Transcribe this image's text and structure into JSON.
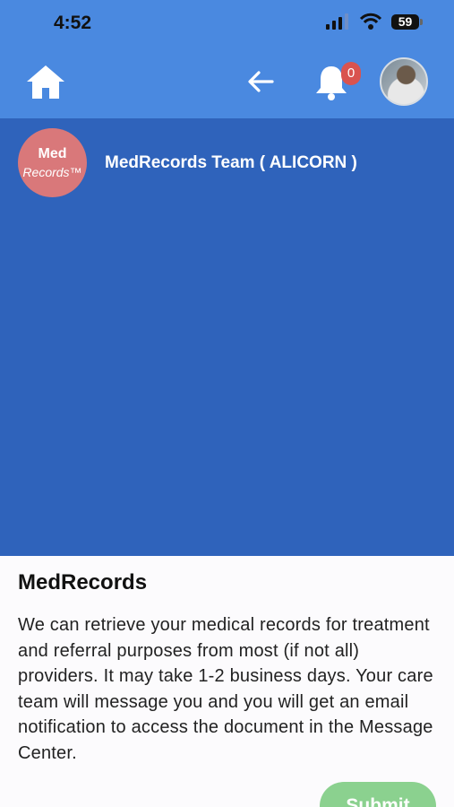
{
  "status_bar": {
    "time": "4:52",
    "battery": "59"
  },
  "header": {
    "notification_count": "0"
  },
  "chat": {
    "team_name": "MedRecords  Team ( ALICORN )",
    "logo_line1": "Med",
    "logo_line2": "Records™"
  },
  "sheet": {
    "title": "MedRecords",
    "body": "We can retrieve your medical records for treatment and referral purposes from most (if not all) providers. It may take 1-2 business days. Your care team will message you and you will get an email notification to access the document in the Message Center.",
    "submit_label": "Submit"
  },
  "colors": {
    "header_bg": "#4a89e0",
    "chat_bg": "#2f63bb",
    "logo_bg": "#d9787a",
    "badge_bg": "#d9534f",
    "submit_bg": "#8bd18f"
  }
}
